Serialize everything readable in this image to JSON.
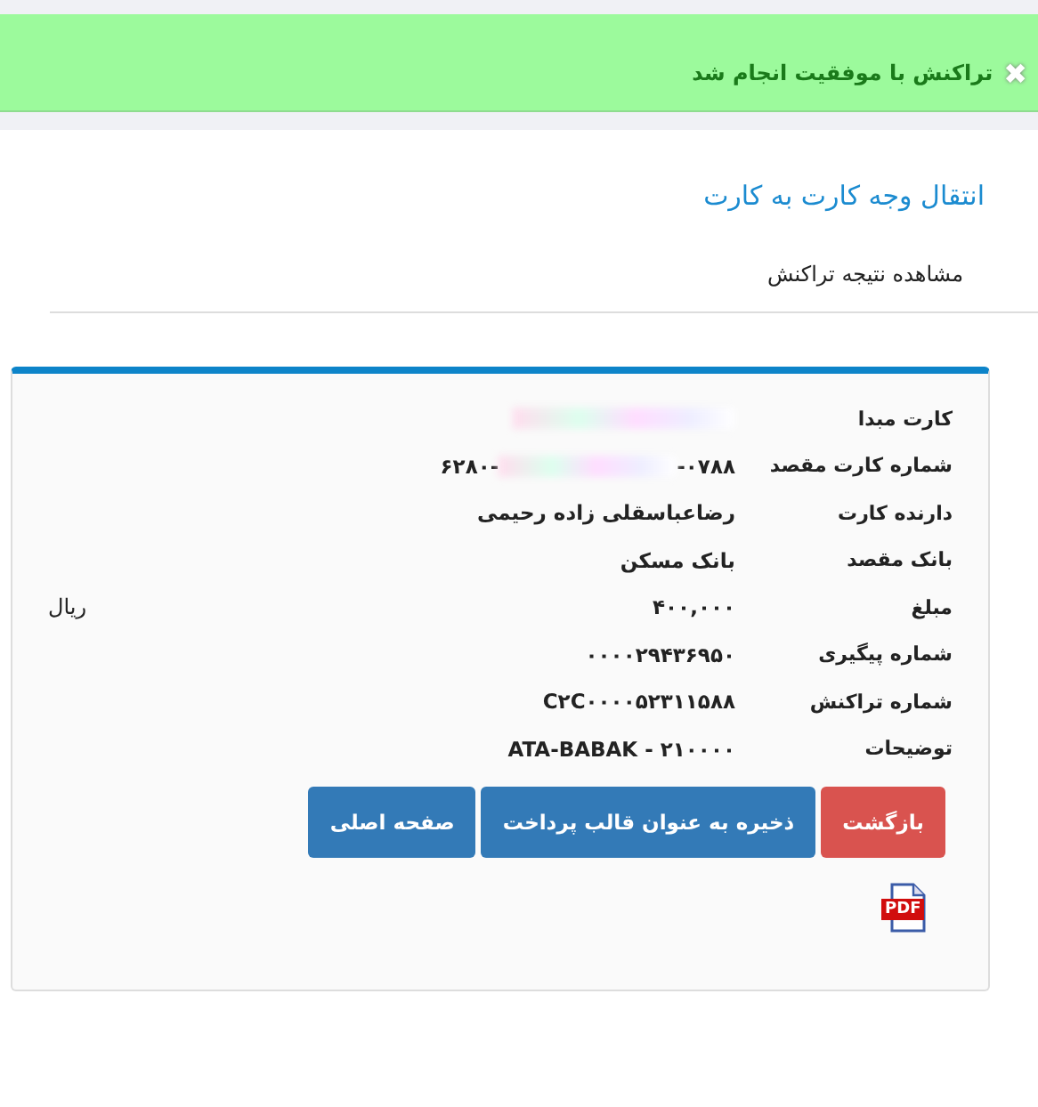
{
  "alert": {
    "kind": "success",
    "message": "تراکنش با موفقیت انجام شد",
    "close": "✖"
  },
  "title": "انتقال وجه کارت به کارت",
  "subtitle": "مشاهده نتیجه تراکنش",
  "details": [
    {
      "label": "کارت مبدا",
      "kind": "redacted"
    },
    {
      "label": "شماره کارت مقصد",
      "kind": "masked",
      "start": "۶۲۸۰-",
      "end": "-۰۷۸۸"
    },
    {
      "label": "دارنده کارت",
      "kind": "text",
      "value": "رضاعباسقلی زاده رحیمی"
    },
    {
      "label": "بانک مقصد",
      "kind": "text",
      "value": "بانک مسکن"
    },
    {
      "label": "مبلغ",
      "kind": "amount",
      "value": "۴۰۰,۰۰۰",
      "unit": "ریال"
    },
    {
      "label": "شماره پیگیری",
      "kind": "text",
      "value": "۰۰۰۰۲۹۴۳۶۹۵۰"
    },
    {
      "label": "شماره تراکنش",
      "kind": "text",
      "value": "C۲C۰۰۰۰۵۲۳۱۱۵۸۸"
    },
    {
      "label": "توضیحات",
      "kind": "text",
      "value": "ATA-BABAK - ۲۱۰۰۰۰"
    }
  ],
  "buttons": [
    {
      "label": "بازگشت",
      "kind": "danger"
    },
    {
      "label": "ذخیره به عنوان قالب پرداخت",
      "kind": "primary"
    },
    {
      "label": "صفحه اصلی",
      "kind": "primary"
    }
  ],
  "pdf": {
    "label": "PDF"
  }
}
